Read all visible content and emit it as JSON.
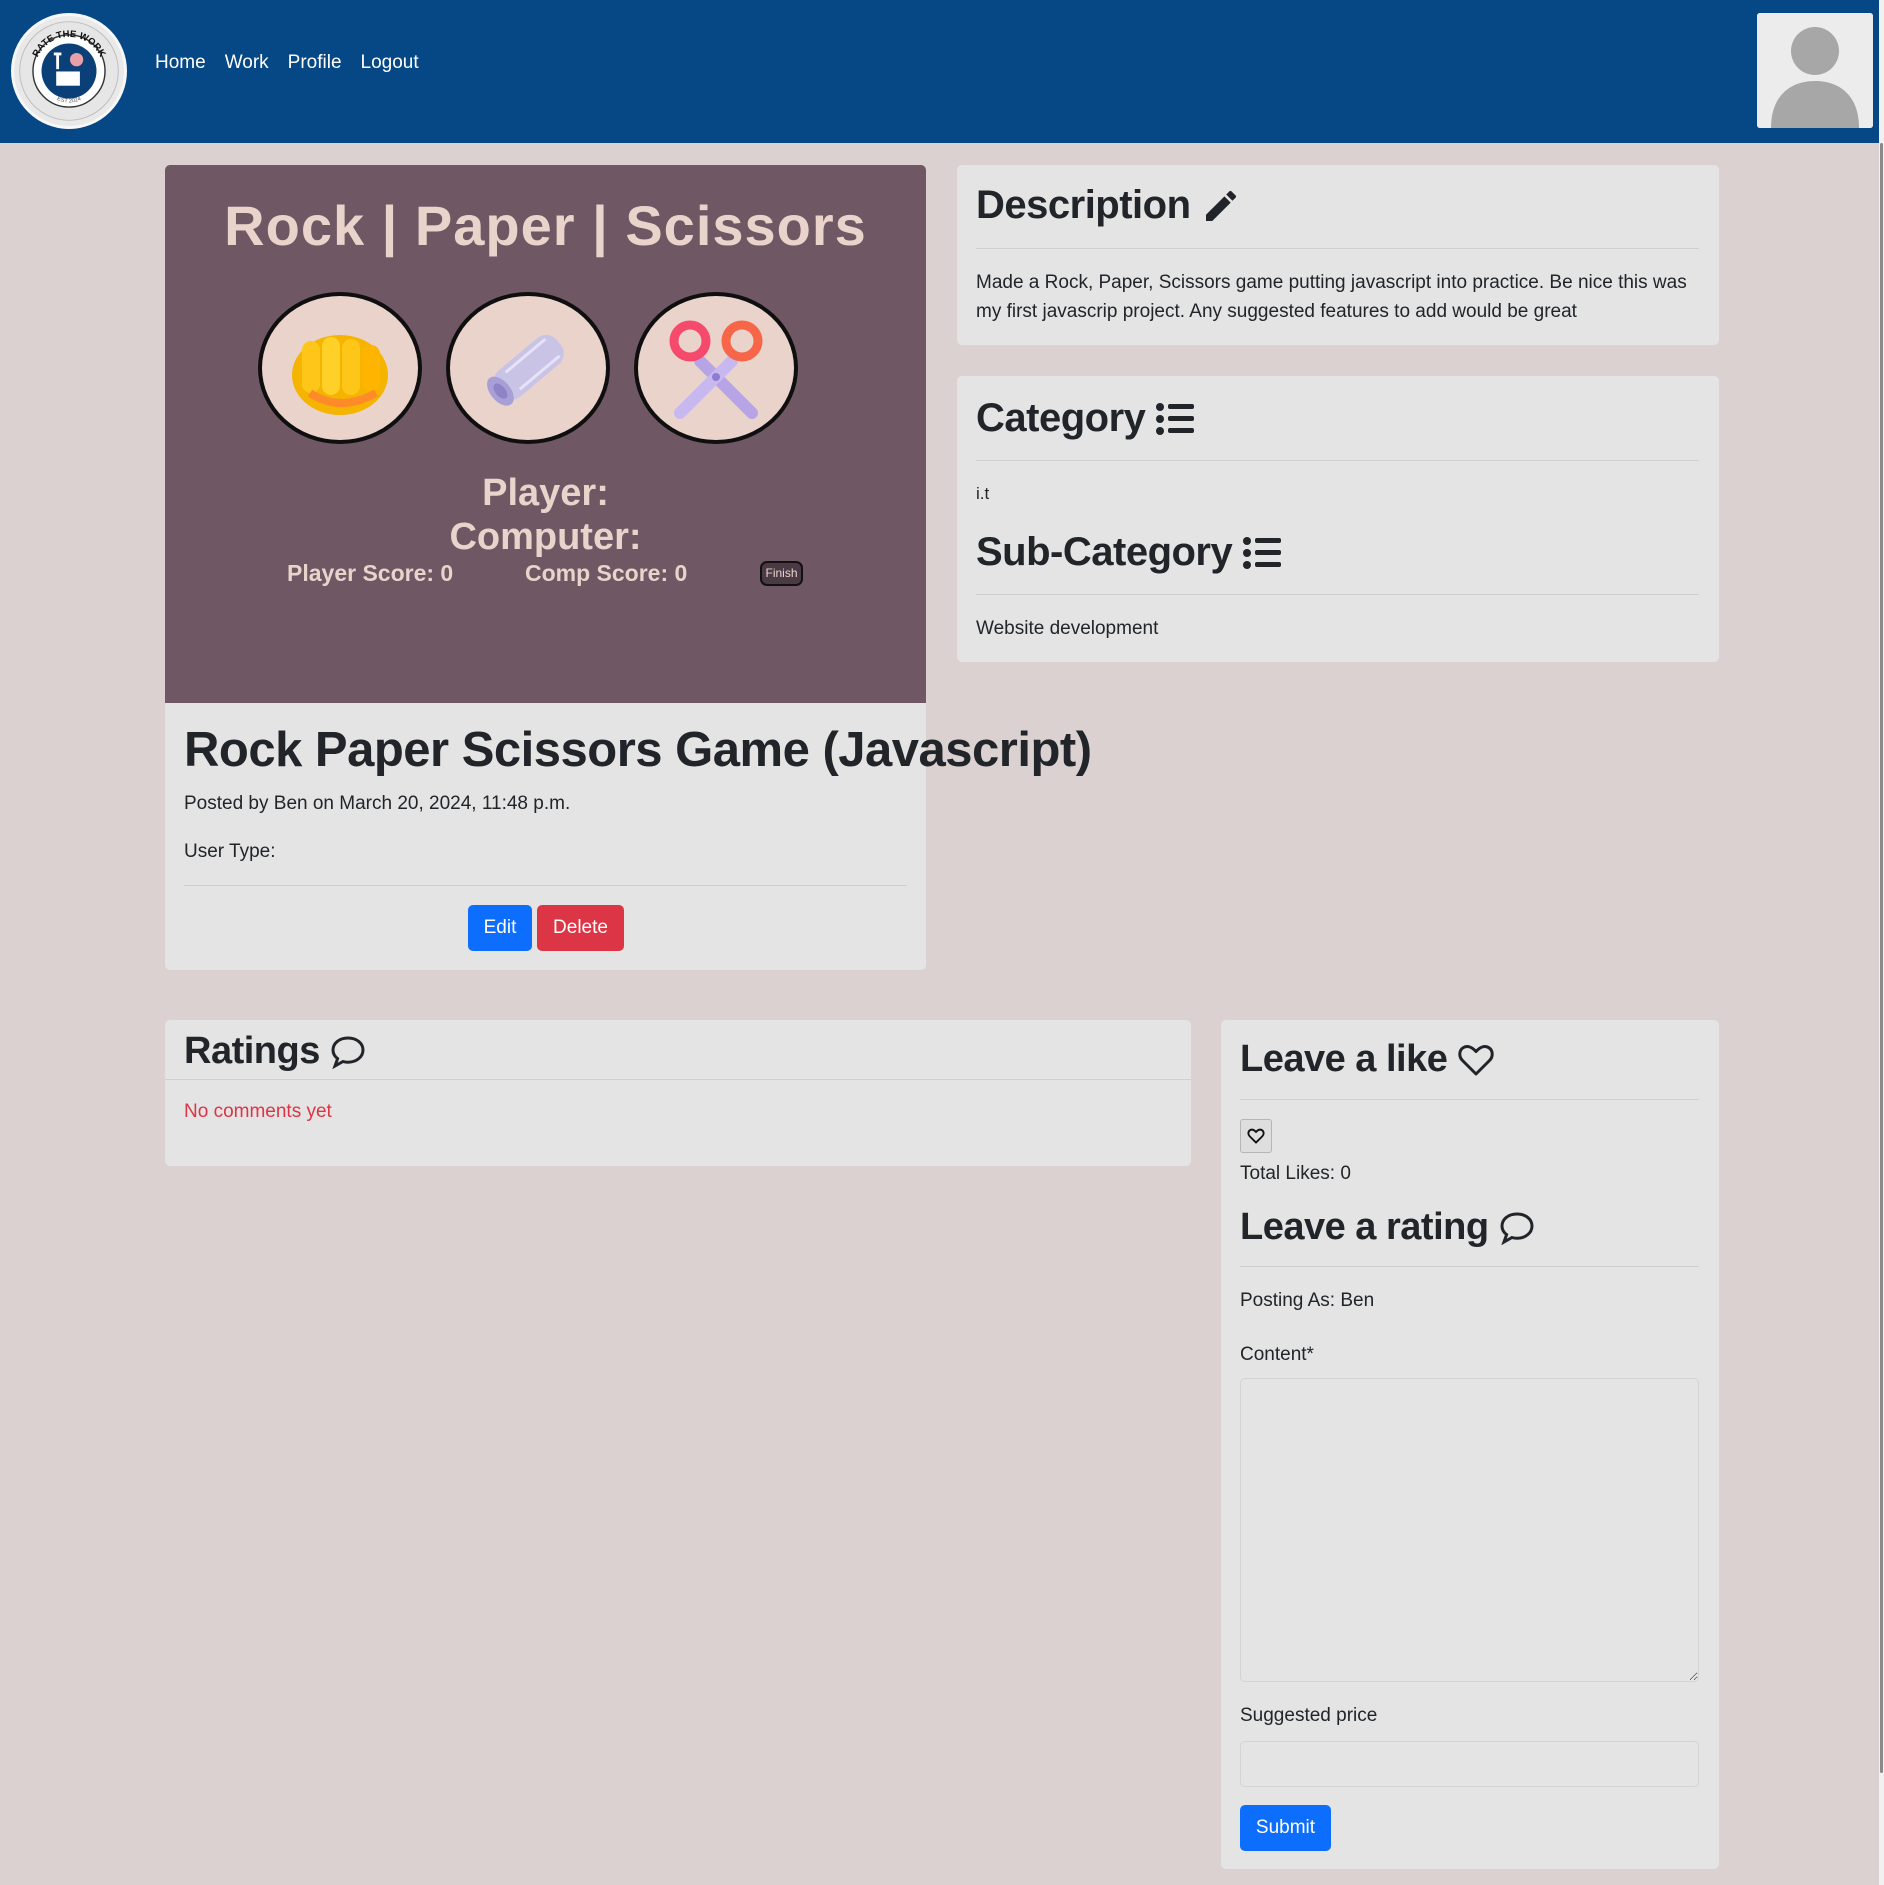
{
  "nav": {
    "links": [
      "Home",
      "Work",
      "Profile",
      "Logout"
    ],
    "logo_text_top": "RATE THE WORK",
    "logo_text_bottom": "EST 2024"
  },
  "game": {
    "title": "Rock | Paper | Scissors",
    "player_label": "Player:",
    "computer_label": "Computer:",
    "player_score": "Player Score: 0",
    "comp_score": "Comp Score: 0",
    "finish_label": "Finish"
  },
  "post": {
    "title": "Rock Paper Scissors Game (Javascript)",
    "meta": "Posted by Ben on March 20, 2024, 11:48 p.m.",
    "user_type": "User Type:",
    "edit_label": "Edit",
    "delete_label": "Delete"
  },
  "description": {
    "heading": "Description",
    "text": "Made a Rock, Paper, Scissors game putting javascript into practice. Be nice this was my first javascrip project. Any suggested features to add would be great"
  },
  "category": {
    "heading": "Category",
    "value": "i.t",
    "sub_heading": "Sub-Category",
    "sub_value": "Website development"
  },
  "ratings": {
    "heading": "Ratings",
    "empty_text": "No comments yet"
  },
  "like": {
    "heading": "Leave a like",
    "total": "Total Likes: 0"
  },
  "rating_form": {
    "heading": "Leave a rating",
    "posting_as": "Posting As: Ben",
    "content_label": "Content*",
    "content_value": "",
    "price_label": "Suggested price",
    "price_value": "",
    "submit_label": "Submit"
  },
  "colors": {
    "navbar": "#064785",
    "page_bg": "#dbd1d1",
    "card_bg": "#e4e4e4",
    "game_bg": "#6f5764",
    "game_text": "#ead3cb",
    "primary": "#0d6efd",
    "danger": "#dc3545"
  },
  "icons": [
    "pencil-icon",
    "list-icon",
    "chat-icon",
    "heart-icon",
    "user-avatar-icon"
  ]
}
